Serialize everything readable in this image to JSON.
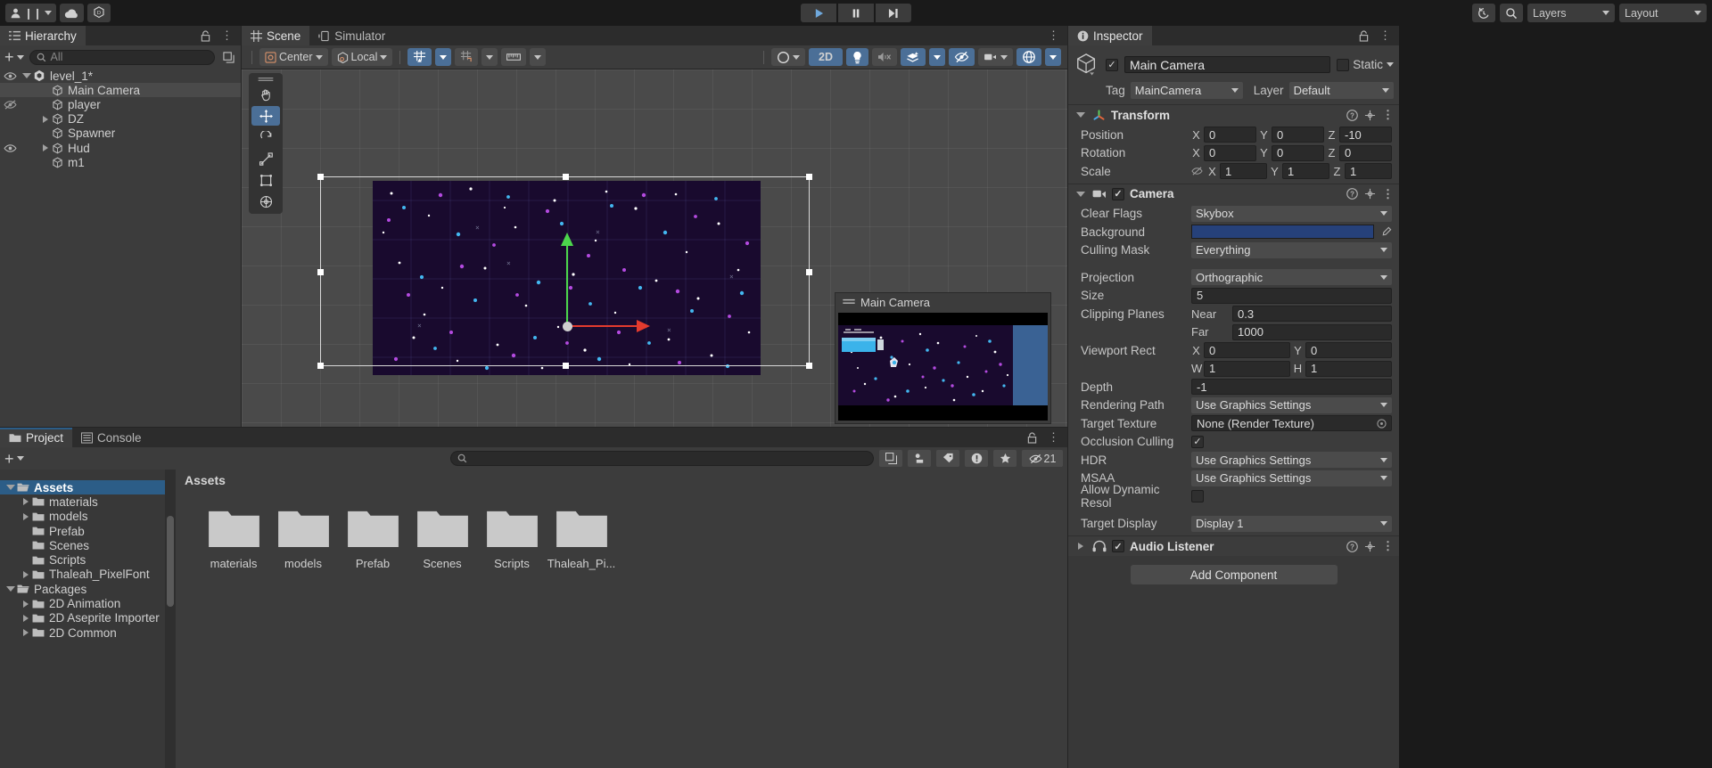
{
  "toolbar": {
    "account_icon": "account-icon",
    "pause_icon": "pause-icon",
    "cloud_icon": "cloud-icon",
    "unity_version_icon": "unity-services-icon",
    "play_icon": "play-icon",
    "pause_btn_icon": "pause-icon",
    "step_icon": "step-icon",
    "history_icon": "history-icon",
    "search_icon": "search-icon",
    "layers_label": "Layers",
    "layout_label": "Layout"
  },
  "hierarchy": {
    "tab_label": "Hierarchy",
    "tab_icon": "hierarchy-icon",
    "add_label": "+",
    "search_placeholder": "All",
    "search_icon": "search-icon",
    "lock_icon": "lock-icon",
    "menu_icon": "kebab-menu-icon",
    "items": [
      {
        "label": "level_1*",
        "depth": 0,
        "icon": "unity-scene-icon",
        "expanded": true,
        "eye": "visible",
        "selected": false
      },
      {
        "label": "Main Camera",
        "depth": 1,
        "icon": "gameobject-icon",
        "expanded": null,
        "eye": "none",
        "selected": true
      },
      {
        "label": "player",
        "depth": 1,
        "icon": "gameobject-icon",
        "expanded": null,
        "eye": "hidden",
        "selected": false
      },
      {
        "label": "DZ",
        "depth": 1,
        "icon": "gameobject-icon",
        "expanded": false,
        "eye": "none",
        "selected": false
      },
      {
        "label": "Spawner",
        "depth": 1,
        "icon": "gameobject-icon",
        "expanded": null,
        "eye": "none",
        "selected": false
      },
      {
        "label": "Hud",
        "depth": 1,
        "icon": "gameobject-icon",
        "expanded": false,
        "eye": "visible",
        "selected": false
      },
      {
        "label": "m1",
        "depth": 1,
        "icon": "gameobject-icon",
        "expanded": null,
        "eye": "none",
        "selected": false
      }
    ]
  },
  "scene": {
    "tabs": [
      {
        "label": "Scene",
        "icon": "grid-icon",
        "active": true
      },
      {
        "label": "Simulator",
        "icon": "device-icon",
        "active": false
      }
    ],
    "lock_icon": "lock-icon",
    "menu_icon": "kebab-menu-icon",
    "pivot_label": "Center",
    "pivot_icon": "pivot-icon",
    "space_label": "Local",
    "space_icon": "space-icon",
    "grid_icon": "grid-snap-icon",
    "snap_icon": "snap-increment-icon",
    "ruler_icon": "ruler-icon",
    "shading_icon": "shading-mode-icon",
    "mode_2d_label": "2D",
    "light_icon": "lighting-icon",
    "audio_icon": "audio-mute-icon",
    "fx_icon": "effects-icon",
    "hidden_icon": "scene-visibility-icon",
    "camera_icon": "scene-camera-icon",
    "gizmos_icon": "gizmos-icon",
    "tools": [
      {
        "name": "hand-tool",
        "icon": "hand-icon",
        "active": false
      },
      {
        "name": "move-tool",
        "icon": "move-icon",
        "active": true
      },
      {
        "name": "rotate-tool",
        "icon": "rotate-icon",
        "active": false
      },
      {
        "name": "scale-tool",
        "icon": "scale-icon",
        "active": false
      },
      {
        "name": "rect-tool",
        "icon": "rect-icon",
        "active": false
      },
      {
        "name": "transform-tool",
        "icon": "transform-icon",
        "active": false
      }
    ],
    "camera_preview_title": "Main Camera",
    "camera_preview_icon": "camera-preview-icon"
  },
  "inspector": {
    "tab_label": "Inspector",
    "tab_icon": "info-icon",
    "lock_icon": "lock-icon",
    "menu_icon": "kebab-menu-icon",
    "object_name": "Main Camera",
    "object_icon": "gameobject-icon",
    "enabled": true,
    "static_label": "Static",
    "tag_label": "Tag",
    "tag_value": "MainCamera",
    "layer_label": "Layer",
    "layer_value": "Default",
    "components": [
      {
        "name": "Transform",
        "icon": "transform-gizmo-icon",
        "expanded": true,
        "enabled": null,
        "rows": [
          {
            "label": "Position",
            "type": "vec3",
            "x": "0",
            "y": "0",
            "z": "-10"
          },
          {
            "label": "Rotation",
            "type": "vec3",
            "x": "0",
            "y": "0",
            "z": "0"
          },
          {
            "label": "Scale",
            "type": "vec3",
            "x": "1",
            "y": "1",
            "z": "1",
            "link_icon": "constrain-proportions-icon"
          }
        ]
      },
      {
        "name": "Camera",
        "icon": "camera-icon",
        "expanded": true,
        "enabled": true,
        "rows": [
          {
            "label": "Clear Flags",
            "type": "dropdown",
            "value": "Skybox"
          },
          {
            "label": "Background",
            "type": "color",
            "value": "#26417a",
            "eyedropper_icon": "eyedropper-icon"
          },
          {
            "label": "Culling Mask",
            "type": "dropdown",
            "value": "Everything"
          },
          {
            "label": "spacer",
            "type": "spacer"
          },
          {
            "label": "Projection",
            "type": "dropdown",
            "value": "Orthographic"
          },
          {
            "label": "Size",
            "type": "value",
            "value": "5"
          },
          {
            "label": "Clipping Planes",
            "type": "subvalue",
            "sub_label": "Near",
            "value": "0.3"
          },
          {
            "label": "",
            "type": "subvalue",
            "sub_label": "Far",
            "value": "1000"
          },
          {
            "label": "Viewport Rect",
            "type": "rect_xy",
            "x_label": "X",
            "x": "0",
            "y_label": "Y",
            "y": "0"
          },
          {
            "label": "",
            "type": "rect_xy",
            "x_label": "W",
            "x": "1",
            "y_label": "H",
            "y": "1"
          },
          {
            "label": "Depth",
            "type": "value",
            "value": "-1"
          },
          {
            "label": "Rendering Path",
            "type": "dropdown",
            "value": "Use Graphics Settings"
          },
          {
            "label": "Target Texture",
            "type": "objfield",
            "value": "None (Render Texture)"
          },
          {
            "label": "Occlusion Culling",
            "type": "checkbox",
            "checked": true
          },
          {
            "label": "HDR",
            "type": "dropdown",
            "value": "Use Graphics Settings"
          },
          {
            "label": "MSAA",
            "type": "dropdown",
            "value": "Use Graphics Settings"
          },
          {
            "label": "Allow Dynamic Resol",
            "type": "checkbox",
            "checked": false
          },
          {
            "label": "spacer2",
            "type": "spacer"
          },
          {
            "label": "Target Display",
            "type": "dropdown",
            "value": "Display 1"
          }
        ]
      },
      {
        "name": "Audio Listener",
        "icon": "audio-listener-icon",
        "expanded": false,
        "enabled": true,
        "rows": []
      }
    ],
    "add_component_label": "Add Component"
  },
  "project": {
    "tabs": [
      {
        "label": "Project",
        "icon": "folder-icon",
        "active": true
      },
      {
        "label": "Console",
        "icon": "console-icon",
        "active": false
      }
    ],
    "lock_icon": "lock-icon",
    "menu_icon": "kebab-menu-icon",
    "add_label": "+",
    "search_placeholder": "",
    "search_icon": "search-icon",
    "filter_icons": [
      "save-search-icon",
      "type-filter-icon",
      "label-filter-icon",
      "warning-filter-icon",
      "favorite-filter-icon"
    ],
    "hidden_count": "21",
    "hidden_icon": "hidden-assets-icon",
    "breadcrumb": "Assets",
    "tree": [
      {
        "label": "Assets",
        "depth": 0,
        "expanded": true,
        "selected": true,
        "icon": "folder-open-icon"
      },
      {
        "label": "materials",
        "depth": 1,
        "expanded": false,
        "selected": false,
        "icon": "folder-icon"
      },
      {
        "label": "models",
        "depth": 1,
        "expanded": false,
        "selected": false,
        "icon": "folder-icon"
      },
      {
        "label": "Prefab",
        "depth": 1,
        "expanded": null,
        "selected": false,
        "icon": "folder-icon"
      },
      {
        "label": "Scenes",
        "depth": 1,
        "expanded": null,
        "selected": false,
        "icon": "folder-icon"
      },
      {
        "label": "Scripts",
        "depth": 1,
        "expanded": null,
        "selected": false,
        "icon": "folder-icon"
      },
      {
        "label": "Thaleah_PixelFont",
        "depth": 1,
        "expanded": false,
        "selected": false,
        "icon": "folder-icon"
      },
      {
        "label": "Packages",
        "depth": 0,
        "expanded": true,
        "selected": false,
        "icon": "folder-open-icon"
      },
      {
        "label": "2D Animation",
        "depth": 1,
        "expanded": false,
        "selected": false,
        "icon": "folder-icon"
      },
      {
        "label": "2D Aseprite Importer",
        "depth": 1,
        "expanded": false,
        "selected": false,
        "icon": "folder-icon"
      },
      {
        "label": "2D Common",
        "depth": 1,
        "expanded": false,
        "selected": false,
        "icon": "folder-icon"
      }
    ],
    "items": [
      {
        "label": "materials",
        "icon": "folder-icon"
      },
      {
        "label": "models",
        "icon": "folder-icon"
      },
      {
        "label": "Prefab",
        "icon": "folder-icon"
      },
      {
        "label": "Scenes",
        "icon": "folder-icon"
      },
      {
        "label": "Scripts",
        "icon": "folder-icon"
      },
      {
        "label": "Thaleah_Pi...",
        "icon": "folder-icon"
      }
    ]
  },
  "colors": {
    "accent_blue": "#4b6f97",
    "selection_blue": "#2c5d87",
    "panel_bg": "#3c3c3c",
    "window_bg": "#383838",
    "toolbar_bg": "#1a1a1a",
    "scene_bg": "#4a4a4a",
    "sprite_bg": "#190a2e",
    "gizmo_x": "#e33b2e",
    "gizmo_y": "#4cd64c"
  }
}
